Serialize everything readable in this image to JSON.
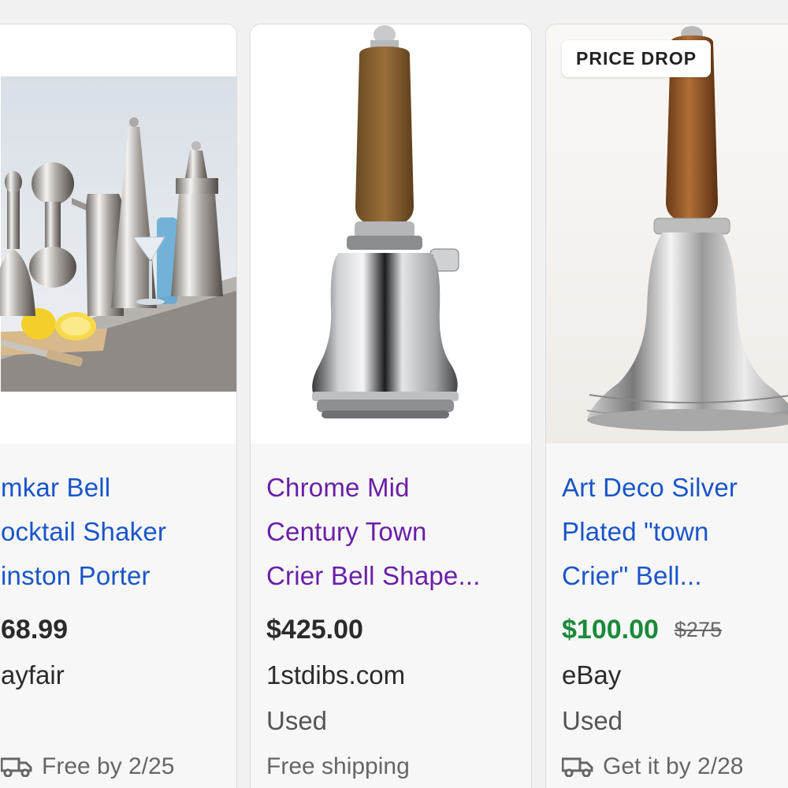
{
  "cards": [
    {
      "title": "mkar Bell\nocktail Shaker\ninston Porter",
      "price": "68.99",
      "store": "ayfair",
      "shipping": "Free by 2/25"
    },
    {
      "title": "Chrome Mid\nCentury Town\nCrier Bell Shape...",
      "price": "$425.00",
      "store": "1stdibs.com",
      "condition": "Used",
      "shipping": "Free shipping"
    },
    {
      "badge": "PRICE DROP",
      "title": "Art Deco Silver\nPlated \"town\nCrier\" Bell...",
      "price": "$100.00",
      "old_price": "$275",
      "store": "eBay",
      "condition": "Used",
      "shipping": "Get it by 2/28"
    }
  ],
  "icons": {
    "card1_shipping": "truck-icon",
    "card3_shipping": "truck-icon"
  },
  "colors": {
    "title_link": "#1a55c8",
    "title_visited": "#6a1fa6",
    "sale_price": "#1a8a3a"
  }
}
